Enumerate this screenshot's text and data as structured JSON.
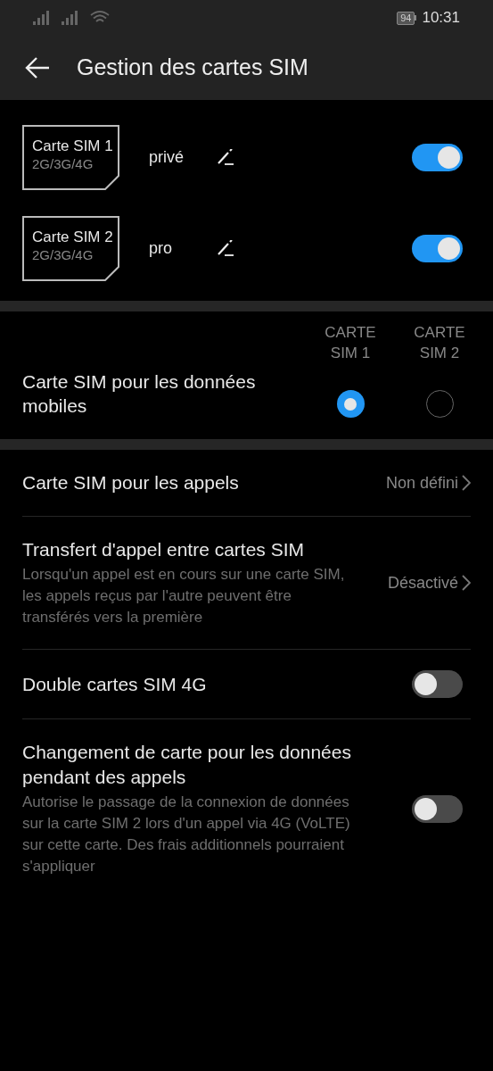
{
  "status_bar": {
    "battery": "94",
    "time": "10:31"
  },
  "app_bar": {
    "title": "Gestion des cartes SIM"
  },
  "sim_cards": [
    {
      "name": "Carte SIM 1",
      "networks": "2G/3G/4G",
      "label": "privé",
      "on": true
    },
    {
      "name": "Carte SIM 2",
      "networks": "2G/3G/4G",
      "label": "pro",
      "on": true
    }
  ],
  "data_sim": {
    "columns": [
      {
        "label": "CARTE SIM 1",
        "selected": true
      },
      {
        "label": "CARTE SIM 2",
        "selected": false
      }
    ],
    "label": "Carte SIM pour les données mobiles"
  },
  "settings": [
    {
      "kind": "nav",
      "title": "Carte SIM pour les appels",
      "value": "Non défini"
    },
    {
      "kind": "nav",
      "title": "Transfert d'appel entre cartes SIM",
      "description": "Lorsqu'un appel est en cours sur une carte SIM, les appels reçus par l'autre peuvent être transférés vers la première",
      "value": "Désactivé"
    },
    {
      "kind": "toggle",
      "title": "Double cartes SIM 4G",
      "on": false
    },
    {
      "kind": "toggle",
      "title": "Changement de carte pour les données pendant des appels",
      "description": "Autorise le passage de la connexion de données sur la carte SIM 2 lors d'un appel via 4G (VoLTE) sur cette carte. Des frais additionnels pourraient s'appliquer",
      "on": false
    }
  ]
}
